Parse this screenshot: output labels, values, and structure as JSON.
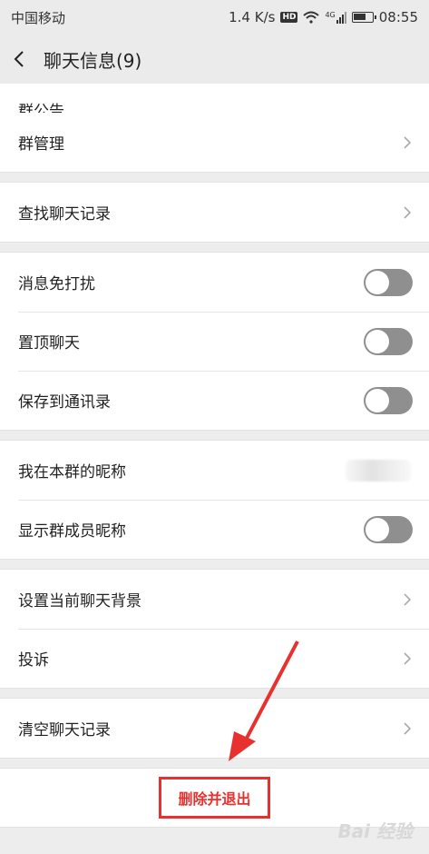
{
  "status_bar": {
    "carrier": "中国移动",
    "network_speed": "1.4 K/s",
    "hd_label": "HD",
    "signal_label": "4G",
    "time": "08:55"
  },
  "header": {
    "title": "聊天信息(9)"
  },
  "sections": {
    "group_notice_partial": "群公告",
    "group_manage": "群管理",
    "search_history": "查找聊天记录",
    "mute": "消息免打扰",
    "pin": "置顶聊天",
    "save_contacts": "保存到通讯录",
    "my_nickname": "我在本群的昵称",
    "show_nicknames": "显示群成员昵称",
    "set_background": "设置当前聊天背景",
    "complain": "投诉",
    "clear_history": "清空聊天记录"
  },
  "toggles": {
    "mute": false,
    "pin": false,
    "save_contacts": false,
    "show_nicknames": false
  },
  "actions": {
    "delete_and_exit": "删除并退出"
  },
  "annotation": {
    "color": "#e8312f"
  },
  "watermark": {
    "text": "Bai 经验"
  }
}
